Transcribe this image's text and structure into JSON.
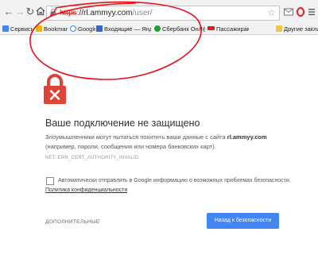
{
  "browser": {
    "url": {
      "scheme": "https",
      "separator": "://",
      "host": "rl.ammyy.com",
      "path": "/user/"
    }
  },
  "bookmarks": [
    {
      "label": "Сервисы",
      "icon": "apps-icon",
      "color": "#4285f4"
    },
    {
      "label": "Bookmarks",
      "icon": "star-icon",
      "color": "#f4b400"
    },
    {
      "label": "Google",
      "icon": "google-icon",
      "color": "#4285f4"
    },
    {
      "label": "Входящие — Яндекс",
      "icon": "mail-icon",
      "color": "#3366cc"
    },
    {
      "label": "Сбербанк ОнЛ@йн",
      "icon": "sberbank-icon",
      "color": "#21a038"
    },
    {
      "label": "Пассажирам",
      "icon": "rzd-icon",
      "color": "#e21a1a"
    },
    {
      "label": "Другие заклад",
      "icon": "folder-icon",
      "color": "#f4c542"
    }
  ],
  "interstitial": {
    "heading": "Ваше подключение не защищено",
    "explanation_prefix": "Злоумышленники могут пытаться похитить ваши данные с сайта",
    "site": "rl.ammyy.com",
    "explanation_suffix": "(например, пароли, сообщения или номера банковских карт).",
    "error_code": "NET::ERR_CERT_AUTHORITY_INVALID",
    "checkbox_label": "Автоматически отправлять в Google информацию о возможных проблемах безопасности.",
    "privacy_link": "Политика конфиденциальности",
    "details_link": "ДОПОЛНИТЕЛЬНЫЕ",
    "back_button": "Назад к безопасности",
    "checkbox_checked": false
  },
  "colors": {
    "danger": "#db4437",
    "primary_button": "#4285f4",
    "annotation": "#e8101a"
  }
}
